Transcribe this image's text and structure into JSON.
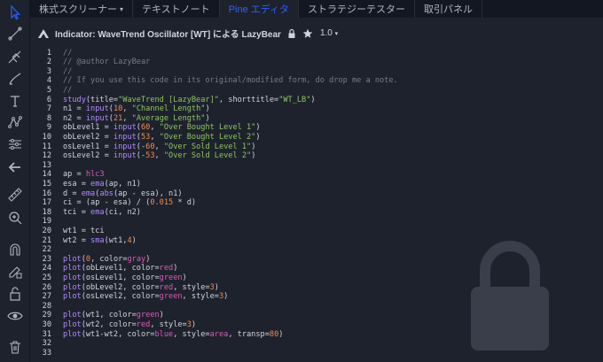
{
  "tabs": [
    {
      "label": "株式スクリーナー",
      "caret": "▾"
    },
    {
      "label": "テキストノート"
    },
    {
      "label": "Pine エディタ"
    },
    {
      "label": "ストラテジーテスター"
    },
    {
      "label": "取引パネル"
    }
  ],
  "header": {
    "title": "Indicator: WaveTrend Oscillator [WT] による LazyBear",
    "version": "1.0",
    "version_caret": "▾"
  },
  "colors": {
    "accent": "#2962ff",
    "background": "#1e222d",
    "tabbar": "#131722",
    "text": "#d1d4dc",
    "comment": "#787b86",
    "string": "#8fc561",
    "number": "#f08c4d",
    "function": "#b28aff",
    "keyword": "#d95bb7"
  },
  "toolbar_icons": [
    "cursor-icon",
    "trend-line-icon",
    "pitchfork-icon",
    "brush-icon",
    "text-icon",
    "pattern-icon",
    "ruler-icon",
    "zoom-icon",
    "magnet-icon",
    "lock-drawing-icon",
    "eye-icon",
    "trash-icon",
    "arrow-left-icon",
    "measure-icon"
  ],
  "code_lines": [
    {
      "n": "1",
      "t": "//"
    },
    {
      "n": "2",
      "t": "// @author LazyBear"
    },
    {
      "n": "3",
      "t": "//"
    },
    {
      "n": "4",
      "t": "// If you use this code in its original/modified form, do drop me a note."
    },
    {
      "n": "5",
      "t": "//"
    },
    {
      "n": "6",
      "t": "study(title=\"WaveTrend [LazyBear]\", shorttitle=\"WT_LB\")"
    },
    {
      "n": "7",
      "t": "n1 = input(10, \"Channel Length\")"
    },
    {
      "n": "8",
      "t": "n2 = input(21, \"Average Length\")"
    },
    {
      "n": "9",
      "t": "obLevel1 = input(60, \"Over Bought Level 1\")"
    },
    {
      "n": "10",
      "t": "obLevel2 = input(53, \"Over Bought Level 2\")"
    },
    {
      "n": "11",
      "t": "osLevel1 = input(-60, \"Over Sold Level 1\")"
    },
    {
      "n": "12",
      "t": "osLevel2 = input(-53, \"Over Sold Level 2\")"
    },
    {
      "n": "13",
      "t": ""
    },
    {
      "n": "14",
      "t": "ap = hlc3"
    },
    {
      "n": "15",
      "t": "esa = ema(ap, n1)"
    },
    {
      "n": "16",
      "t": "d = ema(abs(ap - esa), n1)"
    },
    {
      "n": "17",
      "t": "ci = (ap - esa) / (0.015 * d)"
    },
    {
      "n": "18",
      "t": "tci = ema(ci, n2)"
    },
    {
      "n": "19",
      "t": ""
    },
    {
      "n": "20",
      "t": "wt1 = tci"
    },
    {
      "n": "21",
      "t": "wt2 = sma(wt1,4)"
    },
    {
      "n": "22",
      "t": ""
    },
    {
      "n": "23",
      "t": "plot(0, color=gray)"
    },
    {
      "n": "24",
      "t": "plot(obLevel1, color=red)"
    },
    {
      "n": "25",
      "t": "plot(osLevel1, color=green)"
    },
    {
      "n": "26",
      "t": "plot(obLevel2, color=red, style=3)"
    },
    {
      "n": "27",
      "t": "plot(osLevel2, color=green, style=3)"
    },
    {
      "n": "28",
      "t": ""
    },
    {
      "n": "29",
      "t": "plot(wt1, color=green)"
    },
    {
      "n": "30",
      "t": "plot(wt2, color=red, style=3)"
    },
    {
      "n": "31",
      "t": "plot(wt1-wt2, color=blue, style=area, transp=80)"
    },
    {
      "n": "32",
      "t": ""
    },
    {
      "n": "33",
      "t": ""
    }
  ]
}
